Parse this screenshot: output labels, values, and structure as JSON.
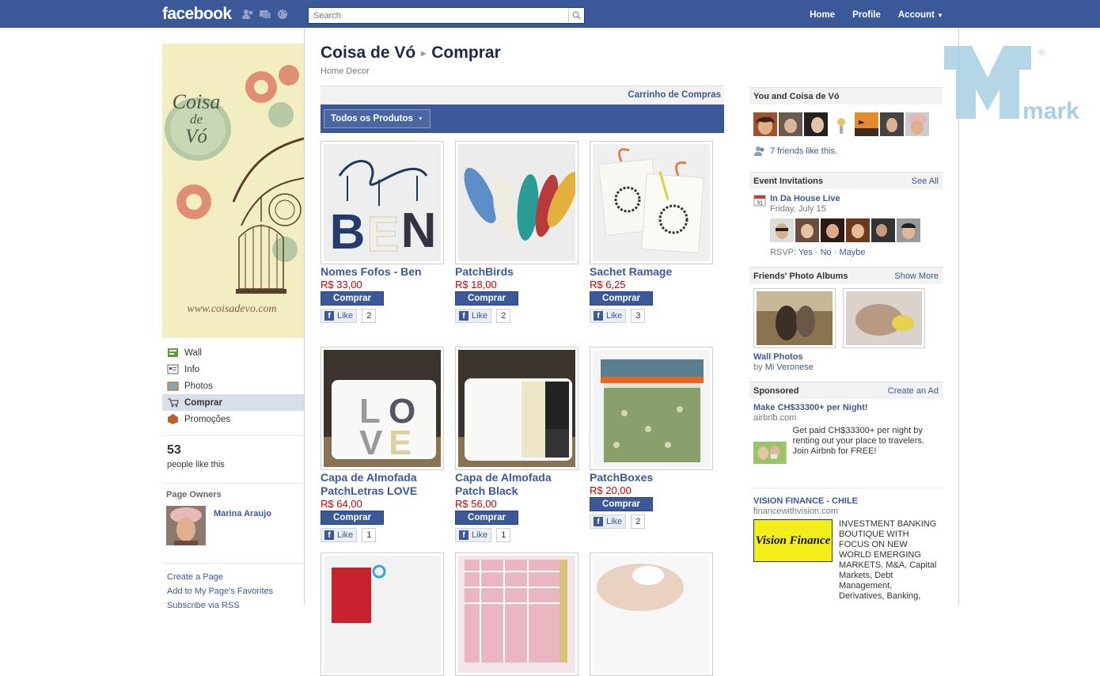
{
  "topbar": {
    "logo": "facebook",
    "search_placeholder": "Search",
    "nav": [
      "Home",
      "Profile",
      "Account"
    ]
  },
  "left": {
    "banner": {
      "brand_line1": "Coisa",
      "brand_line2": "de",
      "brand_line3": "Vó",
      "url": "www.coisadevo.com"
    },
    "menu": [
      {
        "label": "Wall",
        "icon": "wall-icon"
      },
      {
        "label": "Info",
        "icon": "info-icon"
      },
      {
        "label": "Photos",
        "icon": "photos-icon"
      },
      {
        "label": "Comprar",
        "icon": "cart-icon",
        "active": true
      },
      {
        "label": "Promoções",
        "icon": "promo-icon"
      }
    ],
    "likes_count": "53",
    "likes_label": "people like this",
    "owners_heading": "Page Owners",
    "owner_name": "Marina Araujo",
    "links": [
      "Create a Page",
      "Add to My Page's Favorites",
      "Subscribe via RSS"
    ]
  },
  "main": {
    "page_name": "Coisa de Vó",
    "section": "Comprar",
    "category": "Home Decor",
    "cart_link": "Carrinho de Compras",
    "filter": "Todos os Produtos",
    "buy_label": "Comprar",
    "like_label": "Like",
    "products": [
      {
        "name": "Nomes Fofos - Ben",
        "price": "R$ 33,00",
        "likes": "2"
      },
      {
        "name": "PatchBirds",
        "price": "R$ 18,00",
        "likes": "2"
      },
      {
        "name": "Sachet Ramage",
        "price": "R$ 6,25",
        "likes": "3"
      },
      {
        "name": "Capa de Almofada PatchLetras LOVE",
        "price": "R$ 64,00",
        "likes": "1"
      },
      {
        "name": "Capa de Almofada Patch Black",
        "price": "R$ 56,00",
        "likes": "1"
      },
      {
        "name": "PatchBoxes",
        "price": "R$ 20,00",
        "likes": "2"
      }
    ]
  },
  "right": {
    "you_and": "You and Coisa de Vó",
    "friends_like": "7 friends like this.",
    "events_heading": "Event Invitations",
    "see_all": "See All",
    "event_title": "In Da House Live",
    "event_date": "Friday, July 15",
    "rsvp_label": "RSVP:",
    "rsvp_yes": "Yes",
    "rsvp_no": "No",
    "rsvp_maybe": "Maybe",
    "albums_heading": "Friends' Photo Albums",
    "show_more": "Show More",
    "album_title": "Wall Photos",
    "album_by_prefix": "by",
    "album_by": "Mi Veronese",
    "sponsored_heading": "Sponsored",
    "create_ad": "Create an Ad",
    "ads": [
      {
        "title": "Make CH$33300+ per Night!",
        "domain": "airbnb.com",
        "body": "Get paid CH$33300+ per night by renting out your place to travelers. Join Airbnb for FREE!"
      },
      {
        "title": "VISION FINANCE - CHILE",
        "domain": "financewithvision.com",
        "body": "INVESTMENT BANKING BOUTIQUE WITH FOCUS ON NEW WORLD EMERGING MARKETS. M&A, Capital Markets, Debt Management, Derivatives, Banking,",
        "logo_text": "Vision Finance"
      }
    ]
  },
  "watermark": {
    "text": "mark",
    "reg": "®"
  }
}
